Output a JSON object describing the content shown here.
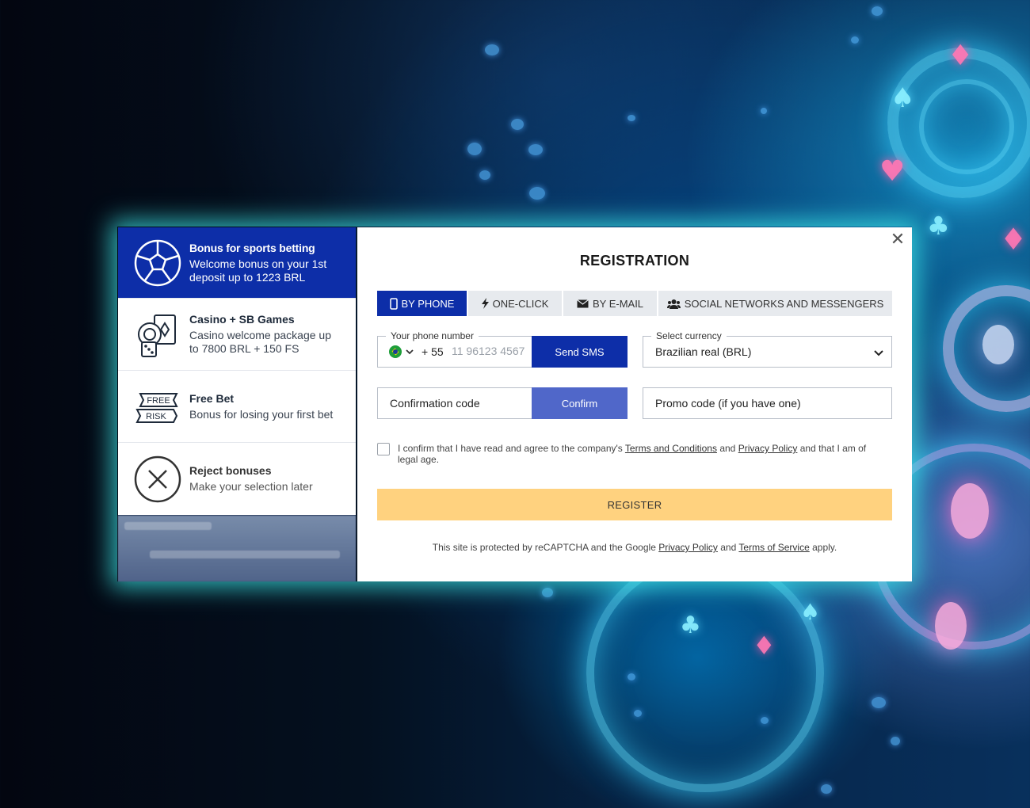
{
  "bonuses": [
    {
      "title": "Bonus for sports betting",
      "desc": "Welcome bonus on your 1st deposit up to 1223 BRL",
      "icon": "soccer-ball-icon"
    },
    {
      "title": "Casino + SB Games",
      "desc": "Casino welcome package up to 7800 BRL + 150 FS",
      "icon": "casino-chips-icon"
    },
    {
      "title": "Free Bet",
      "desc": "Bonus for losing your first bet",
      "icon": "free-risk-ticket-icon",
      "ticket_top": "FREE",
      "ticket_bottom": "RISK"
    },
    {
      "title": "Reject bonuses",
      "desc": "Make your selection later",
      "icon": "reject-x-icon"
    }
  ],
  "registration": {
    "title": "REGISTRATION",
    "close_symbol": "✕",
    "tabs": [
      {
        "label": "BY PHONE",
        "icon": "phone-icon",
        "active": true
      },
      {
        "label": "ONE-CLICK",
        "icon": "lightning-icon",
        "active": false
      },
      {
        "label": "BY E-MAIL",
        "icon": "envelope-icon",
        "active": false
      },
      {
        "label": "SOCIAL NETWORKS AND MESSENGERS",
        "icon": "people-icon",
        "active": false
      }
    ],
    "phone": {
      "legend": "Your phone number",
      "country_code": "+ 55",
      "placeholder": "11 96123 4567",
      "send_label": "Send SMS"
    },
    "currency": {
      "legend": "Select currency",
      "value": "Brazilian real (BRL)"
    },
    "confirmation": {
      "placeholder": "Confirmation code",
      "button": "Confirm"
    },
    "promo": {
      "placeholder": "Promo code (if you have one)"
    },
    "agreement": {
      "prefix": "I confirm that I have read and agree to the company's",
      "terms": "Terms and Conditions",
      "and": "and",
      "privacy": "Privacy Policy",
      "suffix": "and that I am of legal age."
    },
    "register_label": "REGISTER",
    "recaptcha": {
      "prefix": "This site is protected by reCAPTCHA and the Google",
      "privacy": "Privacy Policy",
      "and": "and",
      "terms": "Terms of Service",
      "suffix": "apply."
    }
  },
  "colors": {
    "primary": "#0d2ea8",
    "confirm": "#5067c9",
    "register": "#ffd27f",
    "glow": "#3ce6e6"
  }
}
